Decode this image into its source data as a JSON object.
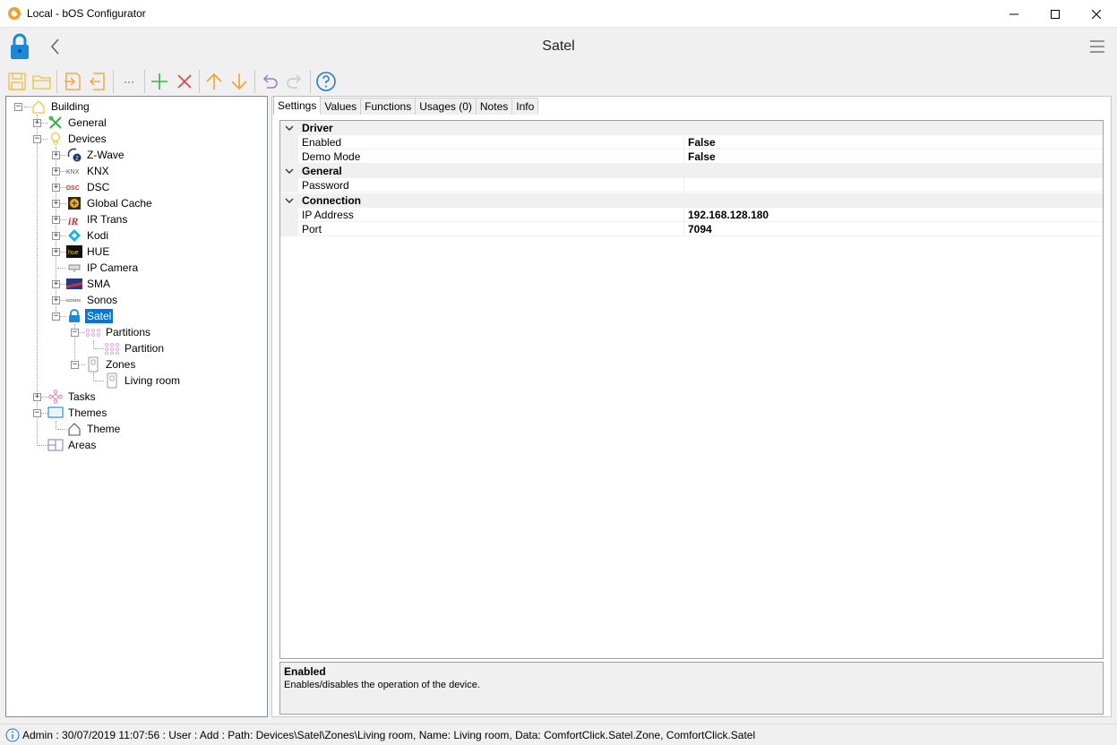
{
  "window": {
    "title": "Local - bOS Configurator"
  },
  "header": {
    "title": "Satel"
  },
  "toolbar": {
    "items": [
      "save-icon",
      "open-folder-icon",
      "import-icon",
      "export-icon",
      "more-icon",
      "add-icon",
      "delete-icon",
      "move-up-icon",
      "move-down-icon",
      "undo-icon",
      "redo-icon",
      "help-icon"
    ],
    "more_label": "···"
  },
  "tree": {
    "building": "Building",
    "general": "General",
    "devices": "Devices",
    "zwave": "Z-Wave",
    "knx": "KNX",
    "dsc": "DSC",
    "global_cache": "Global Cache",
    "ir_trans": "IR Trans",
    "kodi": "Kodi",
    "hue": "HUE",
    "ip_camera": "IP Camera",
    "sma": "SMA",
    "sonos": "Sonos",
    "satel": "Satel",
    "partitions": "Partitions",
    "partition": "Partition",
    "zones": "Zones",
    "living_room": "Living room",
    "tasks": "Tasks",
    "themes": "Themes",
    "theme": "Theme",
    "areas": "Areas"
  },
  "tabs": [
    "Settings",
    "Values",
    "Functions",
    "Usages (0)",
    "Notes",
    "Info"
  ],
  "properties": {
    "driver": {
      "label": "Driver",
      "enabled": {
        "name": "Enabled",
        "value": "False"
      },
      "demo_mode": {
        "name": "Demo Mode",
        "value": "False"
      }
    },
    "general": {
      "label": "General",
      "password": {
        "name": "Password",
        "value": ""
      }
    },
    "connection": {
      "label": "Connection",
      "ip_address": {
        "name": "IP Address",
        "value": "192.168.128.180"
      },
      "port": {
        "name": "Port",
        "value": "7094"
      }
    }
  },
  "help": {
    "title": "Enabled",
    "description": "Enables/disables the operation of the device."
  },
  "status": {
    "text": "Admin : 30/07/2019 11:07:56 : User : Add : Path: Devices\\Satel\\Zones\\Living room, Name: Living room, Data: ComfortClick.Satel.Zone, ComfortClick.Satel"
  },
  "colors": {
    "selection": "#0078d7",
    "accent_orange": "#f0a030",
    "accent_green": "#3cb043",
    "accent_red": "#e04040"
  }
}
